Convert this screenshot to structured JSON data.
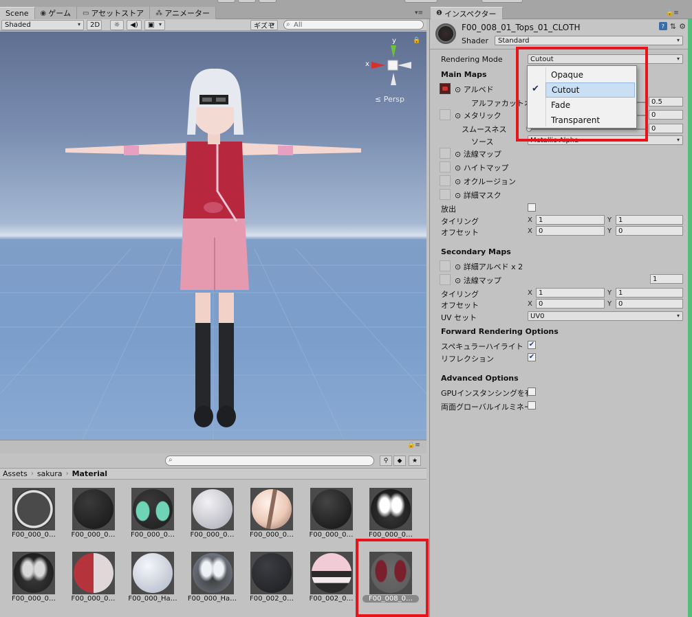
{
  "tabs": {
    "scene": "Scene",
    "game": "ゲーム",
    "asset_store": "アセットストア",
    "animator": "アニメーター",
    "inspector": "インスペクター"
  },
  "scene_toolbar": {
    "shading_mode": "Shaded",
    "mode_2d": "2D",
    "gizmos": "ギズモ",
    "search_placeholder": "All"
  },
  "scene_view": {
    "gizmo_x": "x",
    "gizmo_y": "y",
    "projection": "≤ Persp"
  },
  "project": {
    "breadcrumb": [
      "Assets",
      "sakura",
      "Material"
    ],
    "assets": [
      {
        "label": "F00_000_0…",
        "color_a": "#e0e0e0",
        "color_b": "#111111",
        "style": "ring"
      },
      {
        "label": "F00_000_0…",
        "color_a": "#3a3a3a",
        "color_b": "#151515",
        "style": "dark"
      },
      {
        "label": "F00_000_0…",
        "color_a": "#6fd3b7",
        "color_b": "#1c1c1c",
        "style": "eyes"
      },
      {
        "label": "F00_000_0…",
        "color_a": "#f2f2f4",
        "color_b": "#a9a9b5",
        "style": "plain"
      },
      {
        "label": "F00_000_0…",
        "color_a": "#ecc9b7",
        "color_b": "#8d6b5c",
        "style": "skin"
      },
      {
        "label": "F00_000_0…",
        "color_a": "#444444",
        "color_b": "#101010",
        "style": "dark"
      },
      {
        "label": "F00_000_0…",
        "color_a": "#ffffff",
        "color_b": "#111111",
        "style": "hair"
      },
      {
        "label": "F00_000_0…",
        "color_a": "#d8d8d8",
        "color_b": "#151515",
        "style": "hair"
      },
      {
        "label": "F00_000_0…",
        "color_a": "#b5343c",
        "color_b": "#e0d8d8",
        "style": "split"
      },
      {
        "label": "F00_000_Ha…",
        "color_a": "#f4f6fa",
        "color_b": "#aeb6c6",
        "style": "plain"
      },
      {
        "label": "F00_000_Ha…",
        "color_a": "#eef2f6",
        "color_b": "#7e8694",
        "style": "hair"
      },
      {
        "label": "F00_002_0…",
        "color_a": "#3b3d42",
        "color_b": "#1c1d20",
        "style": "dark"
      },
      {
        "label": "F00_002_0…",
        "color_a": "#f1cbd6",
        "color_b": "#2a2a2a",
        "style": "stripes"
      },
      {
        "label": "F00_008_0…",
        "color_a": "#7a1f2c",
        "color_b": "#5a5a5a",
        "style": "cloth"
      }
    ]
  },
  "inspector": {
    "material_name": "F00_008_01_Tops_01_CLOTH",
    "shader_label": "Shader",
    "shader_value": "Standard",
    "rendering_mode_label": "Rendering Mode",
    "rendering_mode_value": "Cutout",
    "rendering_mode_options": [
      "Opaque",
      "Cutout",
      "Fade",
      "Transparent"
    ],
    "main_maps": "Main Maps",
    "albedo": "⊙ アルベド",
    "alpha_cutoff": "アルファカットオフ",
    "alpha_cutoff_value": "0.5",
    "metallic": "⊙ メタリック",
    "metallic_value": "0",
    "smoothness": "スムースネス",
    "smoothness_value": "0",
    "source": "ソース",
    "source_value": "Metallic Alpha",
    "normal_map": "⊙ 法線マップ",
    "height_map": "⊙ ハイトマップ",
    "occlusion": "⊙ オクルージョン",
    "detail_mask": "⊙ 詳細マスク",
    "emission": "放出",
    "tiling": "タイリング",
    "offset": "オフセット",
    "axis_x": "X",
    "axis_y": "Y",
    "tiling_x": "1",
    "tiling_y": "1",
    "offset_x": "0",
    "offset_y": "0",
    "secondary_maps": "Secondary Maps",
    "detail_albedo": "⊙ 詳細アルベド x 2",
    "normal_map2": "⊙ 法線マップ",
    "normal_map2_value": "1",
    "tiling2_x": "1",
    "tiling2_y": "1",
    "offset2_x": "0",
    "offset2_y": "0",
    "uv_set": "UV セット",
    "uv_set_value": "UV0",
    "forward_options": "Forward Rendering Options",
    "specular_highlights": "スペキュラーハイライト",
    "reflections": "リフレクション",
    "advanced_options": "Advanced Options",
    "gpu_instancing": "GPUインスタンシングを有効に",
    "double_sided_gi": "両面グローバルイルミネーション",
    "check_mark": "✔"
  },
  "colors": {
    "highlight": "#e8141c",
    "dropdown_selected": "#c9dff3"
  }
}
